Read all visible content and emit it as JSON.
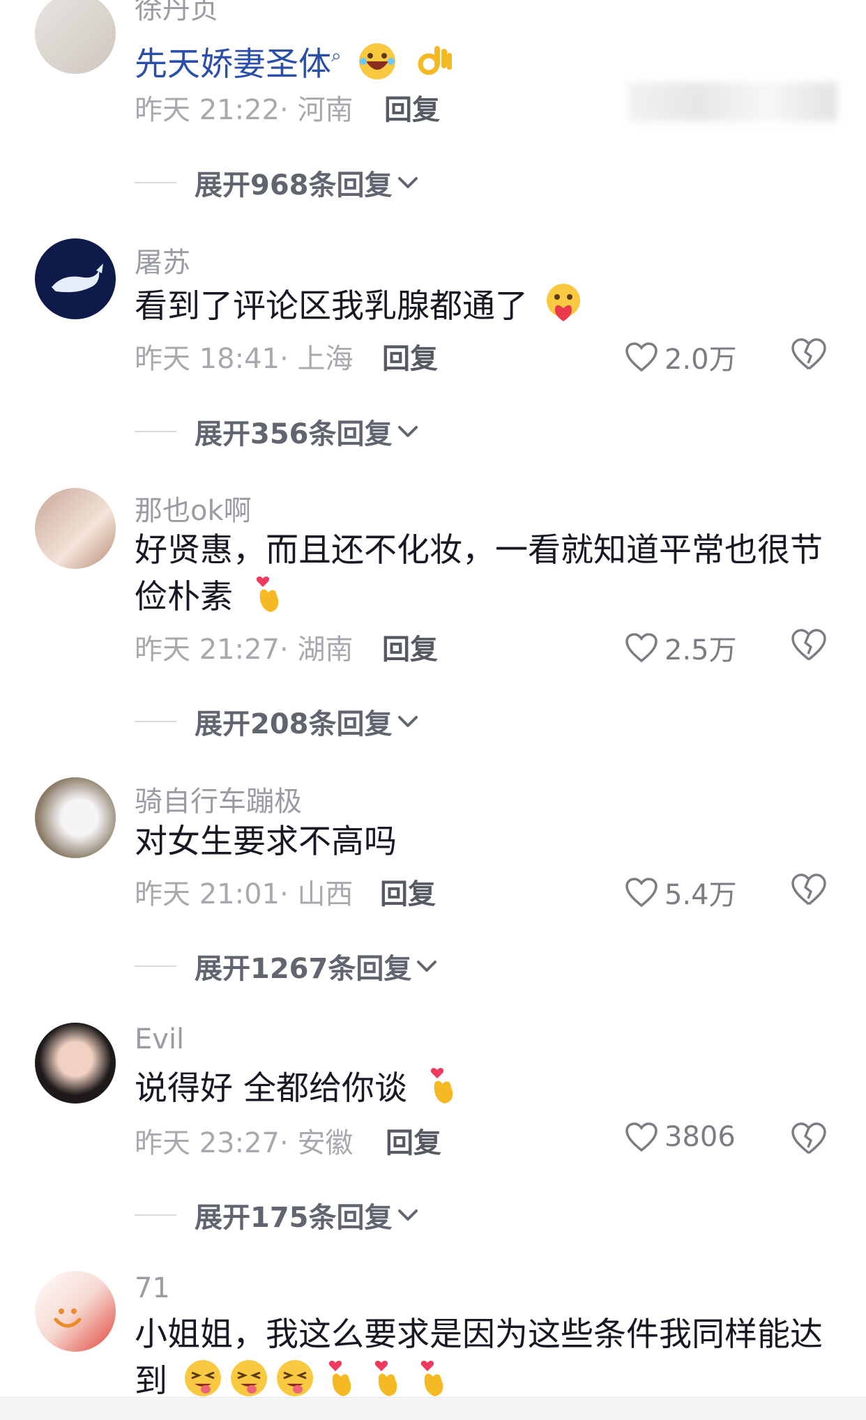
{
  "comments": [
    {
      "username": "徐丹贞",
      "text": "先天娇妻圣体",
      "highlight": true,
      "time": "昨天 21:22",
      "location": "河南",
      "reply_label": "回复",
      "likes": "",
      "expand_label": "展开968条回复",
      "emojis": [
        "search-icon",
        "laugh-emoji",
        "ok-hand-emoji"
      ]
    },
    {
      "username": "屠苏",
      "text": "看到了评论区我乳腺都通了",
      "highlight": false,
      "time": "昨天 18:41",
      "location": "上海",
      "reply_label": "回复",
      "likes": "2.0万",
      "expand_label": "展开356条回复",
      "emojis": [
        "heart-face-emoji"
      ]
    },
    {
      "username": "那也ok啊",
      "text": "好贤惠，而且还不化妆，一看就知道平常也很节俭朴素",
      "highlight": false,
      "time": "昨天 21:27",
      "location": "湖南",
      "reply_label": "回复",
      "likes": "2.5万",
      "expand_label": "展开208条回复",
      "emojis": [
        "finger-heart-emoji"
      ]
    },
    {
      "username": "骑自行车蹦极",
      "text": "对女生要求不高吗",
      "highlight": false,
      "time": "昨天 21:01",
      "location": "山西",
      "reply_label": "回复",
      "likes": "5.4万",
      "expand_label": "展开1267条回复",
      "emojis": []
    },
    {
      "username": "Evil",
      "text": "说得好 全都给你谈",
      "highlight": false,
      "time": "昨天 23:27",
      "location": "安徽",
      "reply_label": "回复",
      "likes": "3806",
      "expand_label": "展开175条回复",
      "emojis": [
        "finger-heart-emoji"
      ]
    },
    {
      "username": "71",
      "text": "小姐姐，我这么要求是因为这些条件我同样能达到",
      "highlight": false,
      "time": "",
      "location": "",
      "reply_label": "",
      "likes": "",
      "expand_label": "",
      "emojis": [
        "wink-tongue-emoji",
        "wink-tongue-emoji",
        "wink-tongue-emoji",
        "finger-heart-emoji",
        "finger-heart-emoji",
        "finger-heart-emoji"
      ]
    }
  ]
}
